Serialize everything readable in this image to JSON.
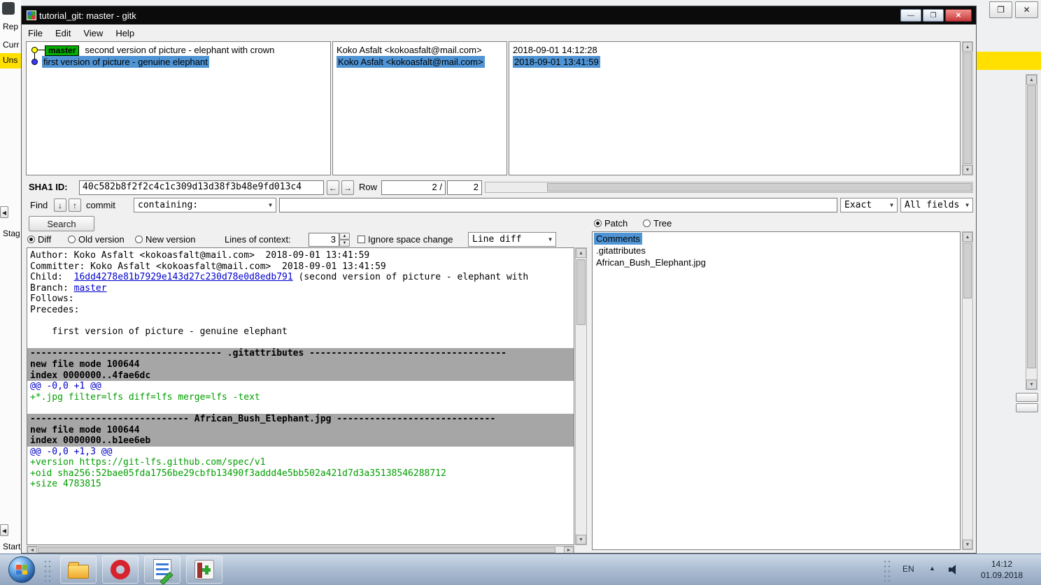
{
  "icons": {
    "back": "←",
    "forward": "→",
    "find_down": "↓",
    "find_up": "↑",
    "dropdown": "▼",
    "spin_up": "▲",
    "spin_down": "▼",
    "scroll_up": "▲",
    "scroll_down": "▼",
    "scroll_left": "◄",
    "scroll_right": "►",
    "minimize": "—",
    "maximize": "❐",
    "close": "✕",
    "restore": "❐",
    "tray_expand": "▲",
    "chevron_left": "◂"
  },
  "colors": {
    "selection": "#4f94d4",
    "branch_tag_green": "#00b000",
    "diff_head_bg": "#a6a6a6",
    "diff_add_green": "#009e00",
    "diff_hunk_blue": "#0000c8",
    "link_blue": "#0000d0",
    "highlight_yellow": "#ffe000",
    "close_red": "#c8393d",
    "titlebar_black": "#0b0b0b"
  },
  "background_left": {
    "fragments": [
      "Rep",
      "Curr",
      "Uns",
      "Stag",
      "Start"
    ]
  },
  "window": {
    "title": "tutorial_git: master - gitk",
    "menu": [
      "File",
      "Edit",
      "View",
      "Help"
    ]
  },
  "commits": [
    {
      "node": "yellow",
      "tag": "master",
      "subject": "second version of picture - elephant with crown",
      "author": "Koko Asfalt <kokoasfalt@mail.com>",
      "date": "2018-09-01 14:12:28",
      "selected": false
    },
    {
      "node": "blue",
      "tag": null,
      "subject": "first version of picture - genuine elephant",
      "author": "Koko Asfalt <kokoasfalt@mail.com>",
      "date": "2018-09-01 13:41:59",
      "selected": true
    }
  ],
  "sha_bar": {
    "label": "SHA1 ID:",
    "value": "40c582b8f2f2c4c1c309d13d38f3b48e9fd013c4",
    "row_label": "Row",
    "row_current": "2 /",
    "row_total": "2"
  },
  "find_bar": {
    "find": "Find",
    "commit": "commit",
    "containing": "containing:",
    "query": "",
    "exact": "Exact",
    "fields": "All fields"
  },
  "search": "Search",
  "diff_controls": {
    "diff": "Diff",
    "old": "Old version",
    "new": "New version",
    "context_label": "Lines of context:",
    "context": "3",
    "ignore": "Ignore space change",
    "mode": "Line diff"
  },
  "patch_tree": {
    "patch": "Patch",
    "tree": "Tree"
  },
  "files": [
    "Comments",
    ".gitattributes",
    "African_Bush_Elephant.jpg"
  ],
  "diff_lines": [
    {
      "cls": "plain",
      "text": "Author: Koko Asfalt <kokoasfalt@mail.com>  2018-09-01 13:41:59"
    },
    {
      "cls": "plain",
      "text": "Committer: Koko Asfalt <kokoasfalt@mail.com>  2018-09-01 13:41:59"
    },
    {
      "cls": "plain",
      "pre": "Child:  ",
      "link": "16dd4278e81b7929e143d27c230d78e0d8edb791",
      "post": " (second version of picture - elephant with"
    },
    {
      "cls": "plain",
      "pre": "Branch: ",
      "link": "master",
      "post": ""
    },
    {
      "cls": "plain",
      "text": "Follows: "
    },
    {
      "cls": "plain",
      "text": "Precedes: "
    },
    {
      "cls": "plain",
      "text": ""
    },
    {
      "cls": "plain",
      "text": "    first version of picture - genuine elephant"
    },
    {
      "cls": "plain",
      "text": ""
    },
    {
      "cls": "head",
      "text": "----------------------------------- .gitattributes ------------------------------------"
    },
    {
      "cls": "head",
      "text": "new file mode 100644"
    },
    {
      "cls": "head",
      "text": "index 0000000..4fae6dc"
    },
    {
      "cls": "hunk",
      "text": "@@ -0,0 +1 @@"
    },
    {
      "cls": "add",
      "text": "+*.jpg filter=lfs diff=lfs merge=lfs -text"
    },
    {
      "cls": "plain",
      "text": ""
    },
    {
      "cls": "head",
      "text": "----------------------------- African_Bush_Elephant.jpg -----------------------------"
    },
    {
      "cls": "head",
      "text": "new file mode 100644"
    },
    {
      "cls": "head",
      "text": "index 0000000..b1ee6eb"
    },
    {
      "cls": "hunk",
      "text": "@@ -0,0 +1,3 @@"
    },
    {
      "cls": "add",
      "text": "+version https://git-lfs.github.com/spec/v1"
    },
    {
      "cls": "add",
      "text": "+oid sha256:52bae05fda1756be29cbfb13490f3addd4e5bb502a421d7d3a35138546288712"
    },
    {
      "cls": "add",
      "text": "+size 4783815"
    }
  ],
  "taskbar": {
    "lang": "EN",
    "time": "14:12",
    "date": "01.09.2018"
  }
}
